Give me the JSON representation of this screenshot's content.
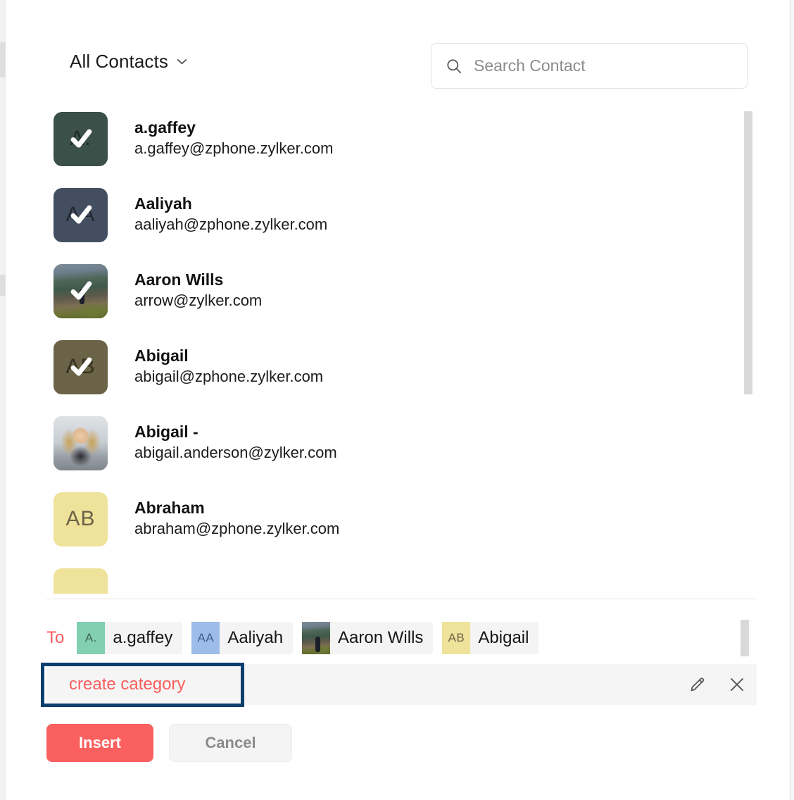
{
  "header": {
    "category_selector_label": "All Contacts",
    "chevron_icon": "chevron-down-icon",
    "search": {
      "icon": "search-icon",
      "value": "",
      "placeholder": "Search Contact"
    }
  },
  "contacts": [
    {
      "name": "a.gaffey",
      "email": "a.gaffey@zphone.zylker.com",
      "initials": "A.",
      "avatar_type": "initials",
      "avatar_bg": "#3b5049",
      "avatar_fg": "#1f2b27",
      "selected": true
    },
    {
      "name": "Aaliyah",
      "email": "aaliyah@zphone.zylker.com",
      "initials": "AA",
      "avatar_type": "initials",
      "avatar_bg": "#434f61",
      "avatar_fg": "#23282f",
      "selected": true
    },
    {
      "name": "Aaron Wills",
      "email": "arrow@zylker.com",
      "initials": "",
      "avatar_type": "photo-mountain",
      "avatar_bg": "#5c6a55",
      "avatar_fg": "#ffffff",
      "selected": true
    },
    {
      "name": "Abigail",
      "email": "abigail@zphone.zylker.com",
      "initials": "AB",
      "avatar_type": "initials",
      "avatar_bg": "#6b6347",
      "avatar_fg": "#35301f",
      "selected": true
    },
    {
      "name": "Abigail -",
      "email": "abigail.anderson@zylker.com",
      "initials": "",
      "avatar_type": "photo-portrait",
      "avatar_bg": "#b9bfc4",
      "avatar_fg": "#ffffff",
      "selected": false
    },
    {
      "name": "Abraham",
      "email": "abraham@zphone.zylker.com",
      "initials": "AB",
      "avatar_type": "initials",
      "avatar_bg": "#efe29a",
      "avatar_fg": "#6b6347",
      "selected": false
    },
    {
      "name": "",
      "email": "",
      "initials": "",
      "avatar_type": "initials",
      "avatar_bg": "#efe29a",
      "avatar_fg": "#6b6347",
      "selected": false
    }
  ],
  "recipients": {
    "label": "To",
    "label_color": "#fa5d5d",
    "chips": [
      {
        "name": "a.gaffey",
        "initials": "A.",
        "avatar_type": "initials",
        "avatar_bg": "#82cfb2",
        "avatar_fg": "#3c6655"
      },
      {
        "name": "Aaliyah",
        "initials": "AA",
        "avatar_type": "initials",
        "avatar_bg": "#9dbce8",
        "avatar_fg": "#3f5e8c"
      },
      {
        "name": "Aaron Wills",
        "initials": "",
        "avatar_type": "photo-mountain",
        "avatar_bg": "#5c6a55",
        "avatar_fg": "#ffffff"
      },
      {
        "name": "Abigail",
        "initials": "AB",
        "avatar_type": "initials",
        "avatar_bg": "#efe29a",
        "avatar_fg": "#6b6347"
      }
    ]
  },
  "category_bar": {
    "name": "create category",
    "name_color": "#fa5d5d",
    "edit_icon": "pencil-icon",
    "close_icon": "close-icon",
    "highlight_color": "#0d3f6e"
  },
  "footer": {
    "insert_label": "Insert",
    "cancel_label": "Cancel",
    "insert_color": "#fb6060"
  }
}
